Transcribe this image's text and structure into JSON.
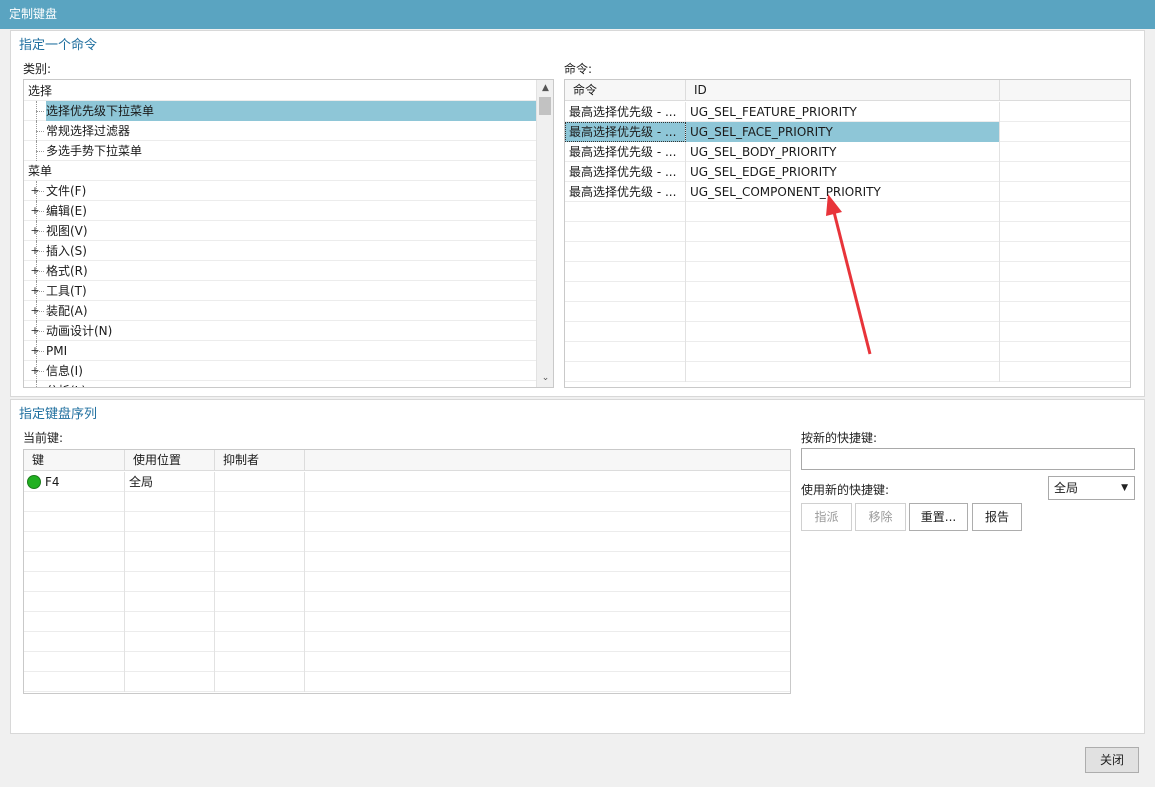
{
  "window": {
    "title": "定制键盘"
  },
  "assign_command": {
    "section_title": "指定一个命令",
    "category_label": "类别:",
    "command_label": "命令:",
    "tree": [
      {
        "label": "选择",
        "level": 0,
        "expander": false
      },
      {
        "label": "选择优先级下拉菜单",
        "level": 1,
        "expander": false,
        "selected": true
      },
      {
        "label": "常规选择过滤器",
        "level": 1,
        "expander": false
      },
      {
        "label": "多选手势下拉菜单",
        "level": 1,
        "expander": false
      },
      {
        "label": "菜单",
        "level": 0,
        "expander": false
      },
      {
        "label": "文件(F)",
        "level": 1,
        "expander": true
      },
      {
        "label": "编辑(E)",
        "level": 1,
        "expander": true
      },
      {
        "label": "视图(V)",
        "level": 1,
        "expander": true
      },
      {
        "label": "插入(S)",
        "level": 1,
        "expander": true
      },
      {
        "label": "格式(R)",
        "level": 1,
        "expander": true
      },
      {
        "label": "工具(T)",
        "level": 1,
        "expander": true
      },
      {
        "label": "装配(A)",
        "level": 1,
        "expander": true
      },
      {
        "label": "动画设计(N)",
        "level": 1,
        "expander": true
      },
      {
        "label": "PMI",
        "level": 1,
        "expander": true
      },
      {
        "label": "信息(I)",
        "level": 1,
        "expander": true
      },
      {
        "label": "分析(L)",
        "level": 1,
        "expander": true
      }
    ],
    "command_columns": [
      "命令",
      "ID"
    ],
    "commands": [
      {
        "name": "最高选择优先级 - ...",
        "id": "UG_SEL_FEATURE_PRIORITY"
      },
      {
        "name": "最高选择优先级 - ...",
        "id": "UG_SEL_FACE_PRIORITY",
        "selected": true
      },
      {
        "name": "最高选择优先级 - ...",
        "id": "UG_SEL_BODY_PRIORITY"
      },
      {
        "name": "最高选择优先级 - ...",
        "id": "UG_SEL_EDGE_PRIORITY"
      },
      {
        "name": "最高选择优先级 - ...",
        "id": "UG_SEL_COMPONENT_PRIORITY"
      }
    ]
  },
  "key_sequence": {
    "section_title": "指定键盘序列",
    "current_keys_label": "当前键:",
    "columns": [
      "键",
      "使用位置",
      "抑制者"
    ],
    "rows": [
      {
        "key": "F4",
        "location": "全局",
        "suppressed_by": "",
        "status": "active"
      }
    ],
    "new_shortcut_label": "按新的快捷键:",
    "new_shortcut_value": "",
    "use_new_label": "使用新的快捷键:",
    "scope_selected": "全局",
    "buttons": {
      "assign": "指派",
      "remove": "移除",
      "reset": "重置...",
      "report": "报告"
    }
  },
  "footer": {
    "close": "关闭"
  },
  "colors": {
    "titlebar": "#5aa4c1",
    "section_title": "#1f6f9f",
    "selection": "#8ec6d7",
    "status_green": "#21b021",
    "annotation_arrow": "#e8343a"
  }
}
